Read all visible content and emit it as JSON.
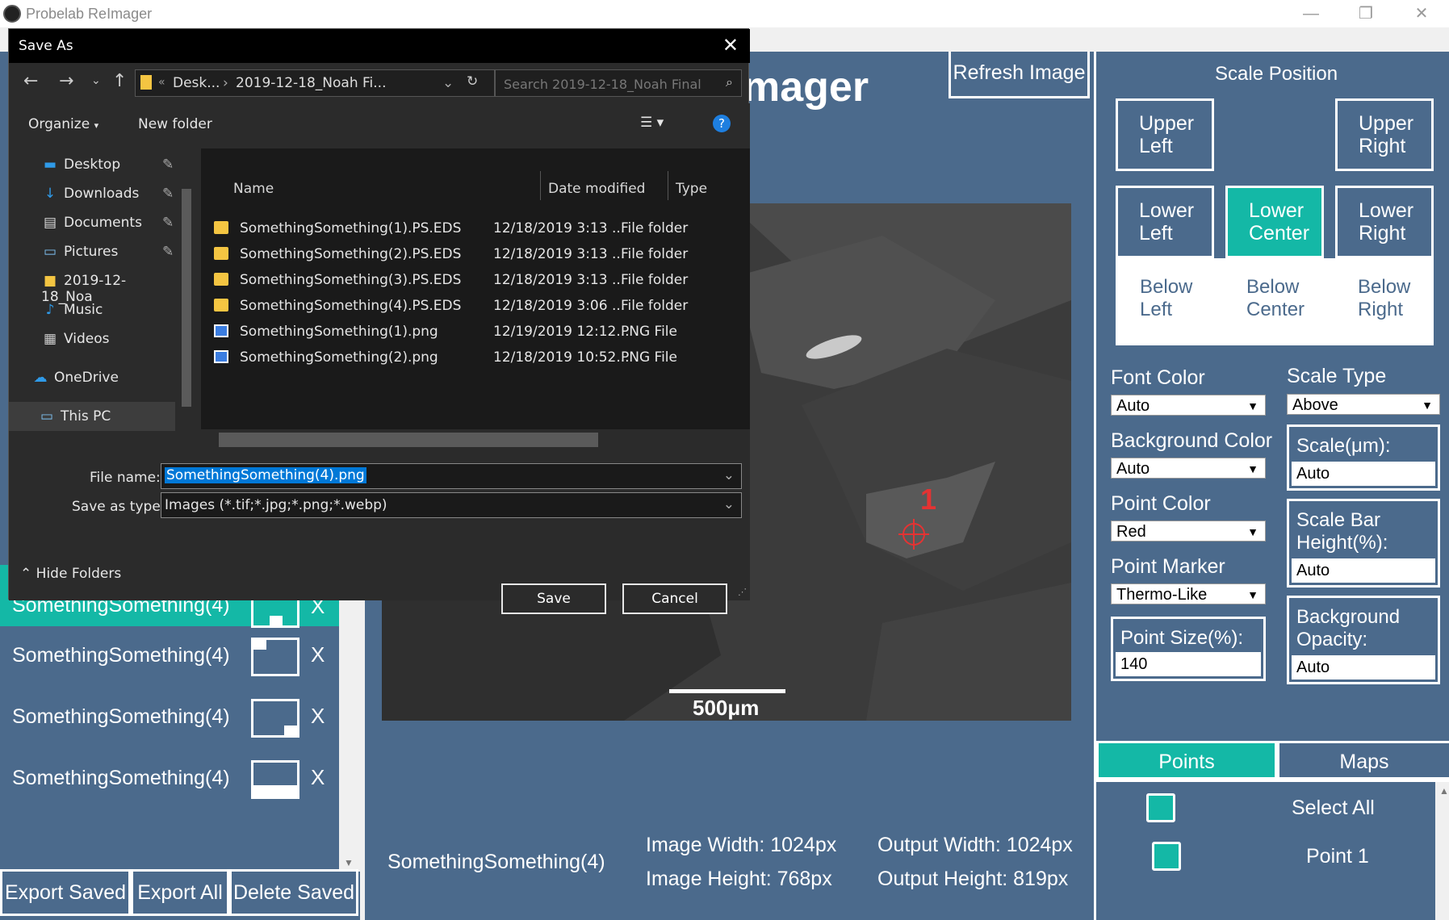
{
  "window": {
    "title": "Probelab ReImager",
    "minimize": "—",
    "maximize": "❐",
    "close": "✕"
  },
  "header": {
    "app_title_visible": "mager",
    "refresh_label": "Refresh Image"
  },
  "image": {
    "scale_label": "500μm",
    "point_label": "1"
  },
  "info": {
    "file_name": "SomethingSomething(4)",
    "image_width": "Image Width: 1024px",
    "image_height": "Image Height: 768px",
    "output_width": "Output Width: 1024px",
    "output_height": "Output Height: 819px"
  },
  "left_panel": {
    "items": [
      {
        "name": "SomethingSomething(4)",
        "x": "X"
      },
      {
        "name": "SomethingSomething(4)",
        "x": "X"
      },
      {
        "name": "SomethingSomething(4)",
        "x": "X"
      },
      {
        "name": "SomethingSomething(4)",
        "x": "X"
      }
    ],
    "export_saved": "Export Saved",
    "export_all": "Export All",
    "delete_saved": "Delete Saved"
  },
  "right_panel": {
    "scale_position_title": "Scale Position",
    "positions": {
      "upper_left": "Upper Left",
      "upper_right": "Upper Right",
      "lower_left": "Lower Left",
      "lower_center": "Lower Center",
      "lower_right": "Lower Right",
      "below_left": "Below Left",
      "below_center": "Below Center",
      "below_right": "Below Right"
    },
    "font_color_label": "Font Color",
    "font_color_value": "Auto",
    "bg_color_label": "Background Color",
    "bg_color_value": "Auto",
    "point_color_label": "Point Color",
    "point_color_value": "Red",
    "point_marker_label": "Point Marker",
    "point_marker_value": "Thermo-Like",
    "point_size_label": "Point Size(%):",
    "point_size_value": "140",
    "scale_type_label": "Scale Type",
    "scale_type_value": "Above",
    "scale_um_label": "Scale(μm):",
    "scale_um_value": "Auto",
    "scale_bar_height_label": "Scale Bar Height(%):",
    "scale_bar_height_value": "Auto",
    "bg_opacity_label": "Background Opacity:",
    "bg_opacity_value": "Auto",
    "tabs": [
      "Points",
      "Maps"
    ],
    "select_all": "Select All",
    "point1": "Point 1"
  },
  "dialog": {
    "title": "Save As",
    "breadcrumb_1": "Desk...",
    "breadcrumb_2": "2019-12-18_Noah Fi...",
    "search_placeholder": "Search 2019-12-18_Noah Final",
    "organize": "Organize",
    "new_folder": "New folder",
    "nav": [
      {
        "label": "Desktop",
        "icon": "desktop-icon"
      },
      {
        "label": "Downloads",
        "icon": "downloads-icon"
      },
      {
        "label": "Documents",
        "icon": "documents-icon"
      },
      {
        "label": "Pictures",
        "icon": "pictures-icon"
      },
      {
        "label": "2019-12-18_Noa",
        "icon": "folder-icon"
      },
      {
        "label": "Music",
        "icon": "music-icon"
      },
      {
        "label": "Videos",
        "icon": "videos-icon"
      },
      {
        "label": "OneDrive",
        "icon": "onedrive-icon"
      },
      {
        "label": "This PC",
        "icon": "this-pc-icon"
      }
    ],
    "columns": {
      "name": "Name",
      "date": "Date modified",
      "type": "Type"
    },
    "files": [
      {
        "name": "SomethingSomething(1).PS.EDS",
        "date": "12/18/2019 3:13 ...",
        "type": "File folder",
        "kind": "folder"
      },
      {
        "name": "SomethingSomething(2).PS.EDS",
        "date": "12/18/2019 3:13 ...",
        "type": "File folder",
        "kind": "folder"
      },
      {
        "name": "SomethingSomething(3).PS.EDS",
        "date": "12/18/2019 3:13 ...",
        "type": "File folder",
        "kind": "folder"
      },
      {
        "name": "SomethingSomething(4).PS.EDS",
        "date": "12/18/2019 3:06 ...",
        "type": "File folder",
        "kind": "folder"
      },
      {
        "name": "SomethingSomething(1).png",
        "date": "12/19/2019 12:12...",
        "type": "PNG File",
        "kind": "png"
      },
      {
        "name": "SomethingSomething(2).png",
        "date": "12/18/2019 10:52...",
        "type": "PNG File",
        "kind": "png"
      }
    ],
    "file_name_label": "File name:",
    "file_name_value": "SomethingSomething(4).png",
    "save_type_label": "Save as type:",
    "save_type_value": "Images (*.tif;*.jpg;*.png;*.webp)",
    "hide_folders": "Hide Folders",
    "save": "Save",
    "cancel": "Cancel"
  },
  "colors": {
    "app_bg": "#4b6a8c",
    "accent": "#14b8a6",
    "point_red": "#e43333"
  }
}
